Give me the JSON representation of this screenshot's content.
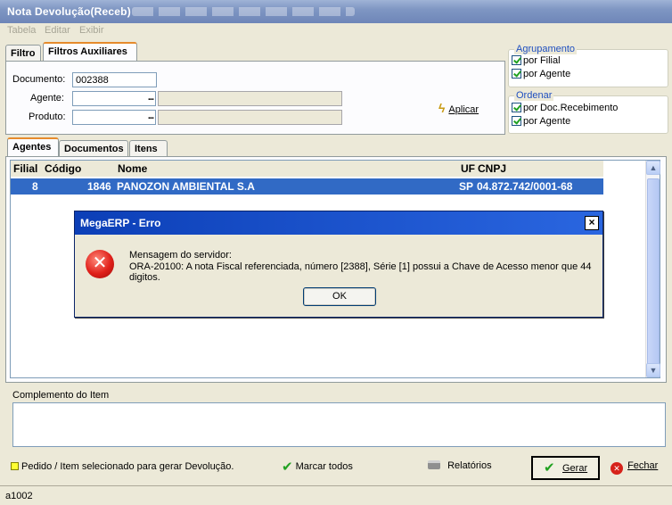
{
  "window": {
    "title": "Nota Devolução(Receb)"
  },
  "menu": [
    "Tabela",
    "Editar",
    "Exibir"
  ],
  "filter_tabs": [
    "Filtro",
    "Filtros Auxiliares"
  ],
  "filters": {
    "documento_label": "Documento:",
    "documento_value": "002388",
    "agente_label": "Agente:",
    "produto_label": "Produto:",
    "dots": "...",
    "aplicar": "Aplicar"
  },
  "agrupamento": {
    "title": "Agrupamento",
    "options": [
      {
        "label": "por Filial",
        "checked": true
      },
      {
        "label": "por Agente",
        "checked": true
      }
    ]
  },
  "ordenar": {
    "title": "Ordenar",
    "options": [
      {
        "label": "por Doc.Recebimento",
        "checked": true
      },
      {
        "label": "por Agente",
        "checked": true
      }
    ]
  },
  "list_tabs": [
    "Agentes",
    "Documentos",
    "Itens"
  ],
  "grid": {
    "columns": [
      "Filial",
      "Código",
      "Nome",
      "UF",
      "CNPJ"
    ],
    "rows": [
      {
        "filial": "8",
        "codigo": "1846",
        "nome": "PANOZON AMBIENTAL S.A",
        "uf": "SP",
        "cnpj": "04.872.742/0001-68"
      }
    ]
  },
  "dialog": {
    "title": "MegaERP - Erro",
    "close": "×",
    "line1": "Mensagem do servidor:",
    "line2": "ORA-20100: A nota Fiscal referenciada, número [2388], Série [1] possui a Chave de Acesso menor que 44 digitos.",
    "ok": "OK"
  },
  "complemento_label": "Complemento do Item",
  "footer": {
    "legend": "Pedido / Item selecionado para gerar Devolução.",
    "marcar_todos": "Marcar todos",
    "relatorios": "Relatórios",
    "gerar": "Gerar",
    "fechar": "Fechar"
  },
  "status": "a1002",
  "colors": {
    "selection": "#316AC5",
    "dialog_title": "#1954D8",
    "legend_yellow": "#FFFF33",
    "tab_accent": "#E68B2C"
  },
  "icons": [
    "bolt-icon",
    "check-icon",
    "error-icon",
    "printer-icon",
    "close-icon",
    "scroll-up-icon",
    "scroll-down-icon"
  ]
}
